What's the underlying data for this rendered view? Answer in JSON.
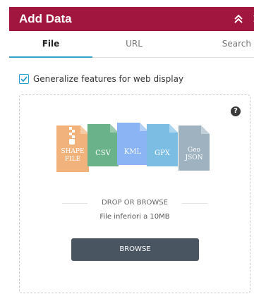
{
  "header": {
    "title": "Add Data",
    "close_glyph": "×"
  },
  "tabs": [
    {
      "label": "File",
      "active": true
    },
    {
      "label": "URL",
      "active": false
    },
    {
      "label": "Search",
      "active": false
    }
  ],
  "options": {
    "generalize_label": "Generalize features for web display",
    "generalize_checked": true
  },
  "dropzone": {
    "help_glyph": "?",
    "file_types": [
      {
        "line1": "SHAPE",
        "line2": "FILE",
        "color": "#f2b27c"
      },
      {
        "line1": "CSV",
        "line2": "",
        "color": "#6ab38a"
      },
      {
        "line1": "KML",
        "line2": "",
        "color": "#8ab4f3"
      },
      {
        "line1": "GPX",
        "line2": "",
        "color": "#7bbde3"
      },
      {
        "line1": "Geo",
        "line2": "JSON",
        "color": "#9fb2bf"
      }
    ],
    "drop_text": "DROP OR BROWSE",
    "size_text": "File inferiori a 10MB",
    "browse_label": "BROWSE"
  },
  "colors": {
    "accent": "#a0163f",
    "tab_underline": "#32a3c7",
    "button": "#4a5562",
    "checkbox": "#2aa0cf"
  }
}
